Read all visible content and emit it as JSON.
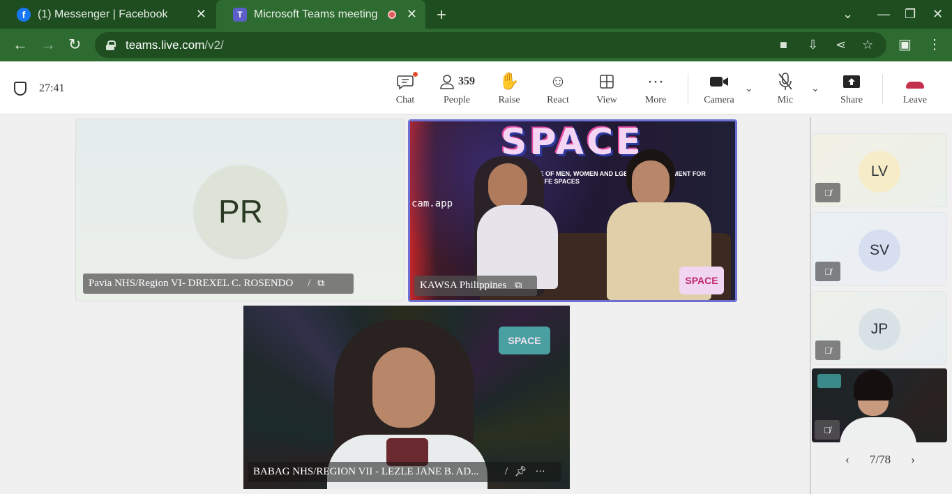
{
  "browser": {
    "tabs": [
      {
        "title": "(1) Messenger | Facebook",
        "icon": "facebook-icon",
        "active": false
      },
      {
        "title": "Microsoft Teams meeting | M",
        "icon": "teams-icon",
        "active": true
      }
    ],
    "url_host": "teams.live.com",
    "url_path": "/v2/"
  },
  "meeting": {
    "timer": "27:41",
    "controls": {
      "chat": "Chat",
      "people": "People",
      "people_count": "359",
      "raise": "Raise",
      "react": "React",
      "view": "View",
      "more": "More",
      "camera": "Camera",
      "mic": "Mic",
      "share": "Share",
      "leave": "Leave"
    }
  },
  "stage": {
    "tiles": [
      {
        "name": "Pavia NHS/Region VI- DREXEL C. ROSENDO",
        "initials": "PR"
      },
      {
        "name": "KAWSA Philippines"
      },
      {
        "name": "BABAG NHS/REGION VII - LEZLE JANE B. AD..."
      }
    ],
    "video_text": {
      "logo": "SPACE",
      "subtitle": "LE OF MEN, WOMEN AND LGBTQIA+ S MOVEMENT FOR SAFE SPACES",
      "watermark": "cam.app"
    }
  },
  "rail": {
    "participants": [
      {
        "initials": "LV",
        "color": "#f6ecc8"
      },
      {
        "initials": "SV",
        "color": "#d6def0"
      },
      {
        "initials": "JP",
        "color": "#d8e2e6"
      }
    ],
    "pager": "7/78"
  },
  "colors": {
    "browser_frame": "#1e4d20",
    "active_speaker_border": "#6d6fd2",
    "leave_red": "#c4314b"
  }
}
